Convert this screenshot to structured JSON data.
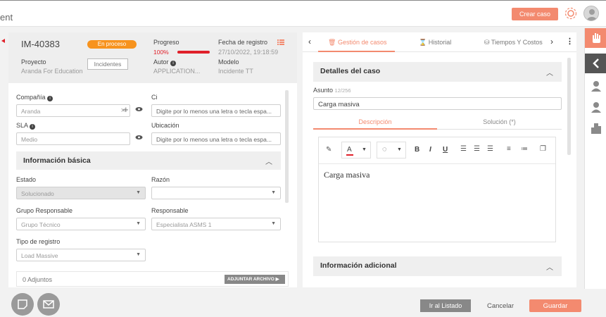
{
  "header": {
    "title": "ent",
    "create_case_label": "Crear caso"
  },
  "summary": {
    "case_id": "IM-40383",
    "status_badge": "En proceso",
    "progress_label": "Progreso",
    "progress_value": "100%",
    "progress_fraction": 1.0,
    "date_label": "Fecha de registro",
    "date_value": "27/10/2022, 19:18:59",
    "project_label": "Proyecto",
    "project_value": "Aranda For Education",
    "type_button": "Incidentes",
    "author_label": "Autor",
    "author_value": "APPLICATION...",
    "model_label": "Modelo",
    "model_value": "Incidente TT"
  },
  "form": {
    "company_label": "Compañía",
    "company_value": "Aranda",
    "ci_label": "Ci",
    "ci_placeholder": "Digite por lo menos una letra o tecla espa...",
    "sla_label": "SLA",
    "sla_value": "Medio",
    "location_label": "Ubicación",
    "location_placeholder": "Digite por lo menos una letra o tecla espa...",
    "basic_info_title": "Información básica",
    "state_label": "Estado",
    "state_value": "Solucionado",
    "reason_label": "Razón",
    "reason_value": "",
    "group_label": "Grupo Responsable",
    "group_value": "Grupo Técnico",
    "responsible_label": "Responsable",
    "responsible_value": "Especialista ASMS 1",
    "register_type_label": "Tipo de registro",
    "register_type_value": "Load Massive",
    "attachments_label": "0 Adjuntos",
    "attach_button": "ADJUNTAR ARCHIVO"
  },
  "right": {
    "tabs": [
      "Gestión de casos",
      "Historial",
      "Tiempos Y Costos"
    ],
    "details_title": "Detalles del caso",
    "subject_label": "Asunto",
    "subject_count": "12/256",
    "subject_value": "Carga masiva",
    "subtabs": [
      "Descripción",
      "Solución (*)"
    ],
    "editor_text": "Carga masiva",
    "toolbar": {
      "bold": "B",
      "italic": "I",
      "underline": "U",
      "text_color": "A"
    },
    "additional_title": "Información adicional"
  },
  "footer": {
    "list_button": "Ir al Listado",
    "cancel_button": "Cancelar",
    "save_button": "Guardar"
  },
  "colors": {
    "accent": "#f38a6f",
    "progress_bar": "#e0202a",
    "badge": "#f7931e"
  }
}
